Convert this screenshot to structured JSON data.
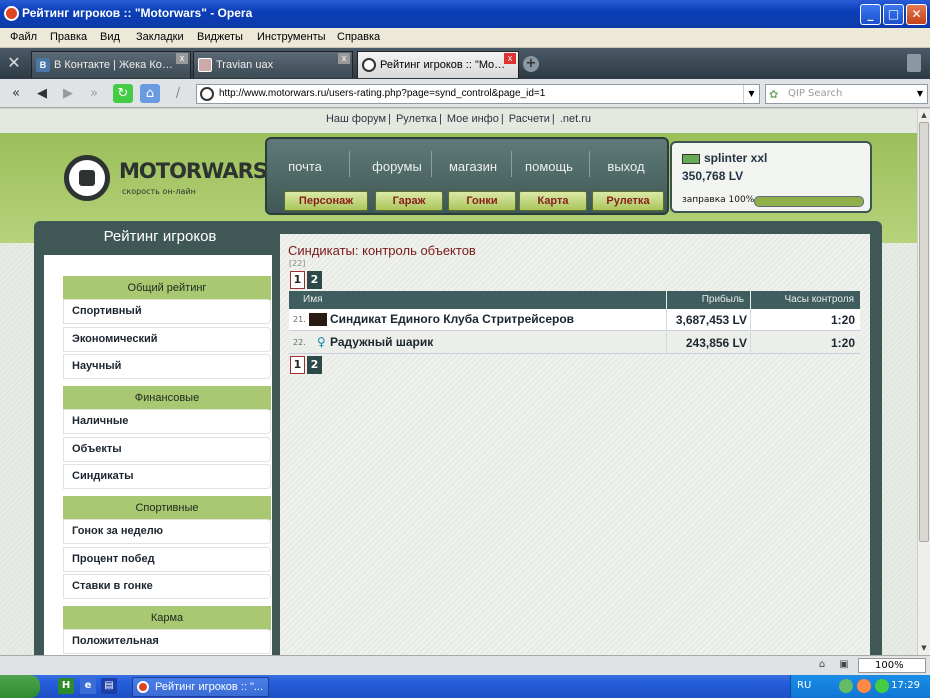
{
  "window": {
    "title": "Рейтинг игроков :: \"Motorwars\" - Opera",
    "minimize": "_",
    "maximize": "□",
    "close": "✕"
  },
  "menu": [
    "Файл",
    "Правка",
    "Вид",
    "Закладки",
    "Виджеты",
    "Инструменты",
    "Справка"
  ],
  "tabs": [
    {
      "label": "В Контакте | Жека Ко…",
      "icon": "vk-icon",
      "close": "x"
    },
    {
      "label": "Travian uax",
      "icon": "travian-icon",
      "close": "x"
    },
    {
      "label": "Рейтинг игроков :: \"Mo…",
      "icon": "motorwars-icon",
      "close": "x",
      "active": true
    }
  ],
  "address": {
    "url": "http://www.motorwars.ru/users-rating.php?page=synd_control&page_id=1",
    "search_placeholder": "QIP Search"
  },
  "site": {
    "toplinks": [
      "Наш форум",
      "Рулетка",
      "Мое инфо",
      "Расчети",
      ".net.ru"
    ],
    "logo_name": "MOTORWARS.RU",
    "logo_sub": "скорость он-лайн",
    "nav": [
      "почта",
      "форумы",
      "магазин",
      "помощь",
      "выход"
    ],
    "buttons": [
      "Персонаж",
      "Гараж",
      "Гонки",
      "Карта",
      "Рулетка"
    ],
    "user": {
      "name": "splinter xxl",
      "money": "350,768 LV",
      "fuel_label": "заправка 100%",
      "fuel_level": 1.0
    }
  },
  "sidebar": {
    "title": "Рейтинг игроков",
    "sections": [
      {
        "head": "Общий рейтинг",
        "items": [
          "Спортивный",
          "Экономический",
          "Научный"
        ]
      },
      {
        "head": "Финансовые",
        "items": [
          "Наличные",
          "Объекты",
          "Синдикаты"
        ]
      },
      {
        "head": "Спортивные",
        "items": [
          "Гонок за неделю",
          "Процент побед",
          "Ставки в гонке"
        ]
      },
      {
        "head": "Карма",
        "items": [
          "Положительная"
        ]
      }
    ]
  },
  "main": {
    "title": "Синдикаты: контроль объектов",
    "count": "[22]",
    "pages": [
      "1",
      "2"
    ],
    "columns": [
      "Имя",
      "Прибыль",
      "Часы контроля"
    ],
    "rows": [
      {
        "num": "21.",
        "name": "Синдикат Единого Клуба Стритрейсеров",
        "profit": "3,687,453 LV",
        "hours": "1:20"
      },
      {
        "num": "22.",
        "name": "Радужный шарик",
        "profit": "243,856 LV",
        "hours": "1:20"
      }
    ]
  },
  "status": {
    "zoom": "100%"
  },
  "taskbar": {
    "item": "Рейтинг игроков :: \"...",
    "lang": "RU",
    "clock": "17:29"
  }
}
